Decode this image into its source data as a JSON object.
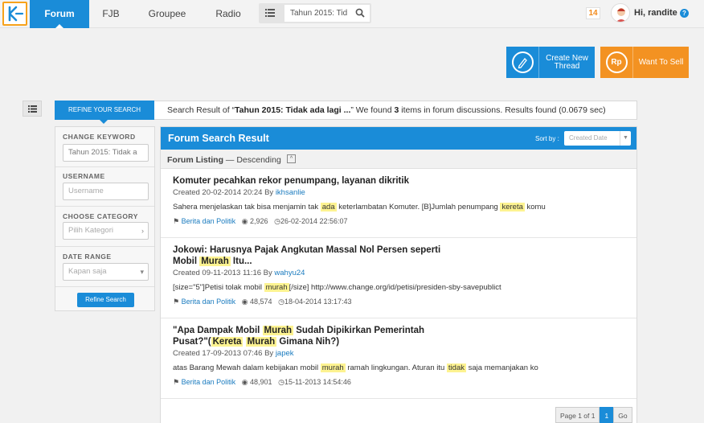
{
  "nav": {
    "tabs": [
      "Forum",
      "FJB",
      "Groupee",
      "Radio"
    ],
    "search_value": "Tahun 2015: Tid",
    "notification_count": "14",
    "greeting": "Hi, randite",
    "help": "?"
  },
  "actions": {
    "create_label": "Create New Thread",
    "create_icon": "pencil-icon",
    "sell_label": "Want To Sell",
    "sell_icon_text": "Rp"
  },
  "refine": {
    "button": "REFINE YOUR SEARCH",
    "result_prefix": "Search Result of “",
    "result_query": "Tahun 2015: Tidak ada lagi ...",
    "result_mid": "” We found ",
    "result_count": "3",
    "result_suffix": " items in forum discussions. Results found (0.0679 sec)"
  },
  "sidebar": {
    "keyword_label": "CHANGE KEYWORD",
    "keyword_value": "Tahun 2015: Tidak a",
    "username_label": "USERNAME",
    "username_placeholder": "Username",
    "category_label": "CHOOSE CATEGORY",
    "category_placeholder": "Pilih Kategori",
    "date_label": "DATE RANGE",
    "date_placeholder": "Kapan saja",
    "submit": "Refine Search"
  },
  "main": {
    "title": "Forum Search Result",
    "sort_label": "Sort by :",
    "sort_value": "Created Date",
    "listing_label": "Forum Listing",
    "listing_order": " — Descending",
    "threads": [
      {
        "title_parts": [
          "Komuter pecahkan rekor penumpang, layanan dikritik"
        ],
        "created": "Created 20-02-2014 20:24 By ",
        "author": "ikhsanlie",
        "snippet": [
          "Sahera menjelaskan tak bisa menjamin tak ",
          "ada",
          " keterlambatan Komuter. [B]Jumlah penumpang ",
          "kereta",
          " komu"
        ],
        "category": "Berita dan Politik",
        "views": "2,926",
        "last": "26-02-2014 22:56:07"
      },
      {
        "title_line1": "Jokowi: Harusnya Pajak Angkutan Massal Nol Persen seperti",
        "title_line2": [
          "Mobil ",
          "Murah",
          " Itu..."
        ],
        "created": "Created 09-11-2013 11:16 By ",
        "author": "wahyu24",
        "snippet": [
          "[size=\"5\"]Petisi tolak mobil ",
          "murah",
          "[/size] http://www.change.org/id/petisi/presiden-sby-savepublict"
        ],
        "category": "Berita dan Politik",
        "views": "48,574",
        "last": "18-04-2014 13:17:43"
      },
      {
        "title_line1": [
          "\"Apa Dampak Mobil ",
          "Murah",
          " Sudah Dipikirkan Pemerintah"
        ],
        "title_line2": [
          "Pusat?\"(",
          "Kereta",
          " ",
          "Murah",
          " Gimana Nih?)"
        ],
        "created": "Created 17-09-2013 07:46 By ",
        "author": "japek",
        "snippet": [
          "atas Barang Mewah dalam kebijakan mobil ",
          "murah",
          " ramah lingkungan. Aturan itu ",
          "tidak",
          " saja memanjakan ko"
        ],
        "category": "Berita dan Politik",
        "views": "48,901",
        "last": "15-11-2013 14:54:46"
      }
    ],
    "pager": {
      "info": "Page 1 of 1",
      "current": "1",
      "go": "Go"
    }
  },
  "colors": {
    "primary": "#1a8cd8",
    "accent": "#f39222",
    "highlight": "#fdf391"
  }
}
